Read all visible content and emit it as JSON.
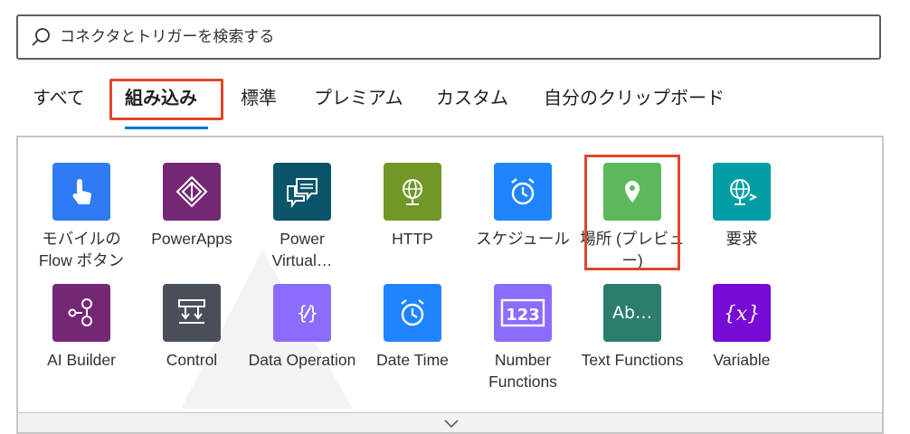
{
  "search": {
    "placeholder": "コネクタとトリガーを検索する",
    "icon": "search-icon"
  },
  "tabs": [
    {
      "label": "すべて",
      "active": false
    },
    {
      "label": "組み込み",
      "active": true
    },
    {
      "label": "標準",
      "active": false
    },
    {
      "label": "プレミアム",
      "active": false
    },
    {
      "label": "カスタム",
      "active": false
    },
    {
      "label": "自分のクリップボード",
      "active": false
    }
  ],
  "connectors": [
    {
      "label": "モバイルの Flow ボタン",
      "icon": "touch-icon",
      "color": "#2f7bf5"
    },
    {
      "label": "PowerApps",
      "icon": "powerapps-icon",
      "color": "#742774"
    },
    {
      "label": "Power Virtual…",
      "icon": "chat-icon",
      "color": "#0b556a"
    },
    {
      "label": "HTTP",
      "icon": "globe-icon",
      "color": "#709727"
    },
    {
      "label": "スケジュール",
      "icon": "alarm-clock-icon",
      "color": "#1f85ff"
    },
    {
      "label": "場所 (プレビュー)",
      "icon": "location-pin-icon",
      "color": "#5cb85c"
    },
    {
      "label": "要求",
      "icon": "globe-arrow-icon",
      "color": "#009da5"
    },
    {
      "label": "AI Builder",
      "icon": "ai-builder-icon",
      "color": "#742774"
    },
    {
      "label": "Control",
      "icon": "control-icon",
      "color": "#484f58"
    },
    {
      "label": "Data Operation",
      "icon": "data-operation-icon",
      "color": "#8c6cff"
    },
    {
      "label": "Date Time",
      "icon": "alarm-clock-icon",
      "color": "#1f85ff"
    },
    {
      "label": "Number Functions",
      "icon": "number-icon",
      "color": "#8c6cff"
    },
    {
      "label": "Text Functions",
      "icon": "text-icon",
      "color": "#2b7d6e"
    },
    {
      "label": "Variable",
      "icon": "variable-icon",
      "color": "#770bd6"
    }
  ],
  "highlights": {
    "accent": "#e0472b",
    "tab_underline": "#0078d4"
  }
}
